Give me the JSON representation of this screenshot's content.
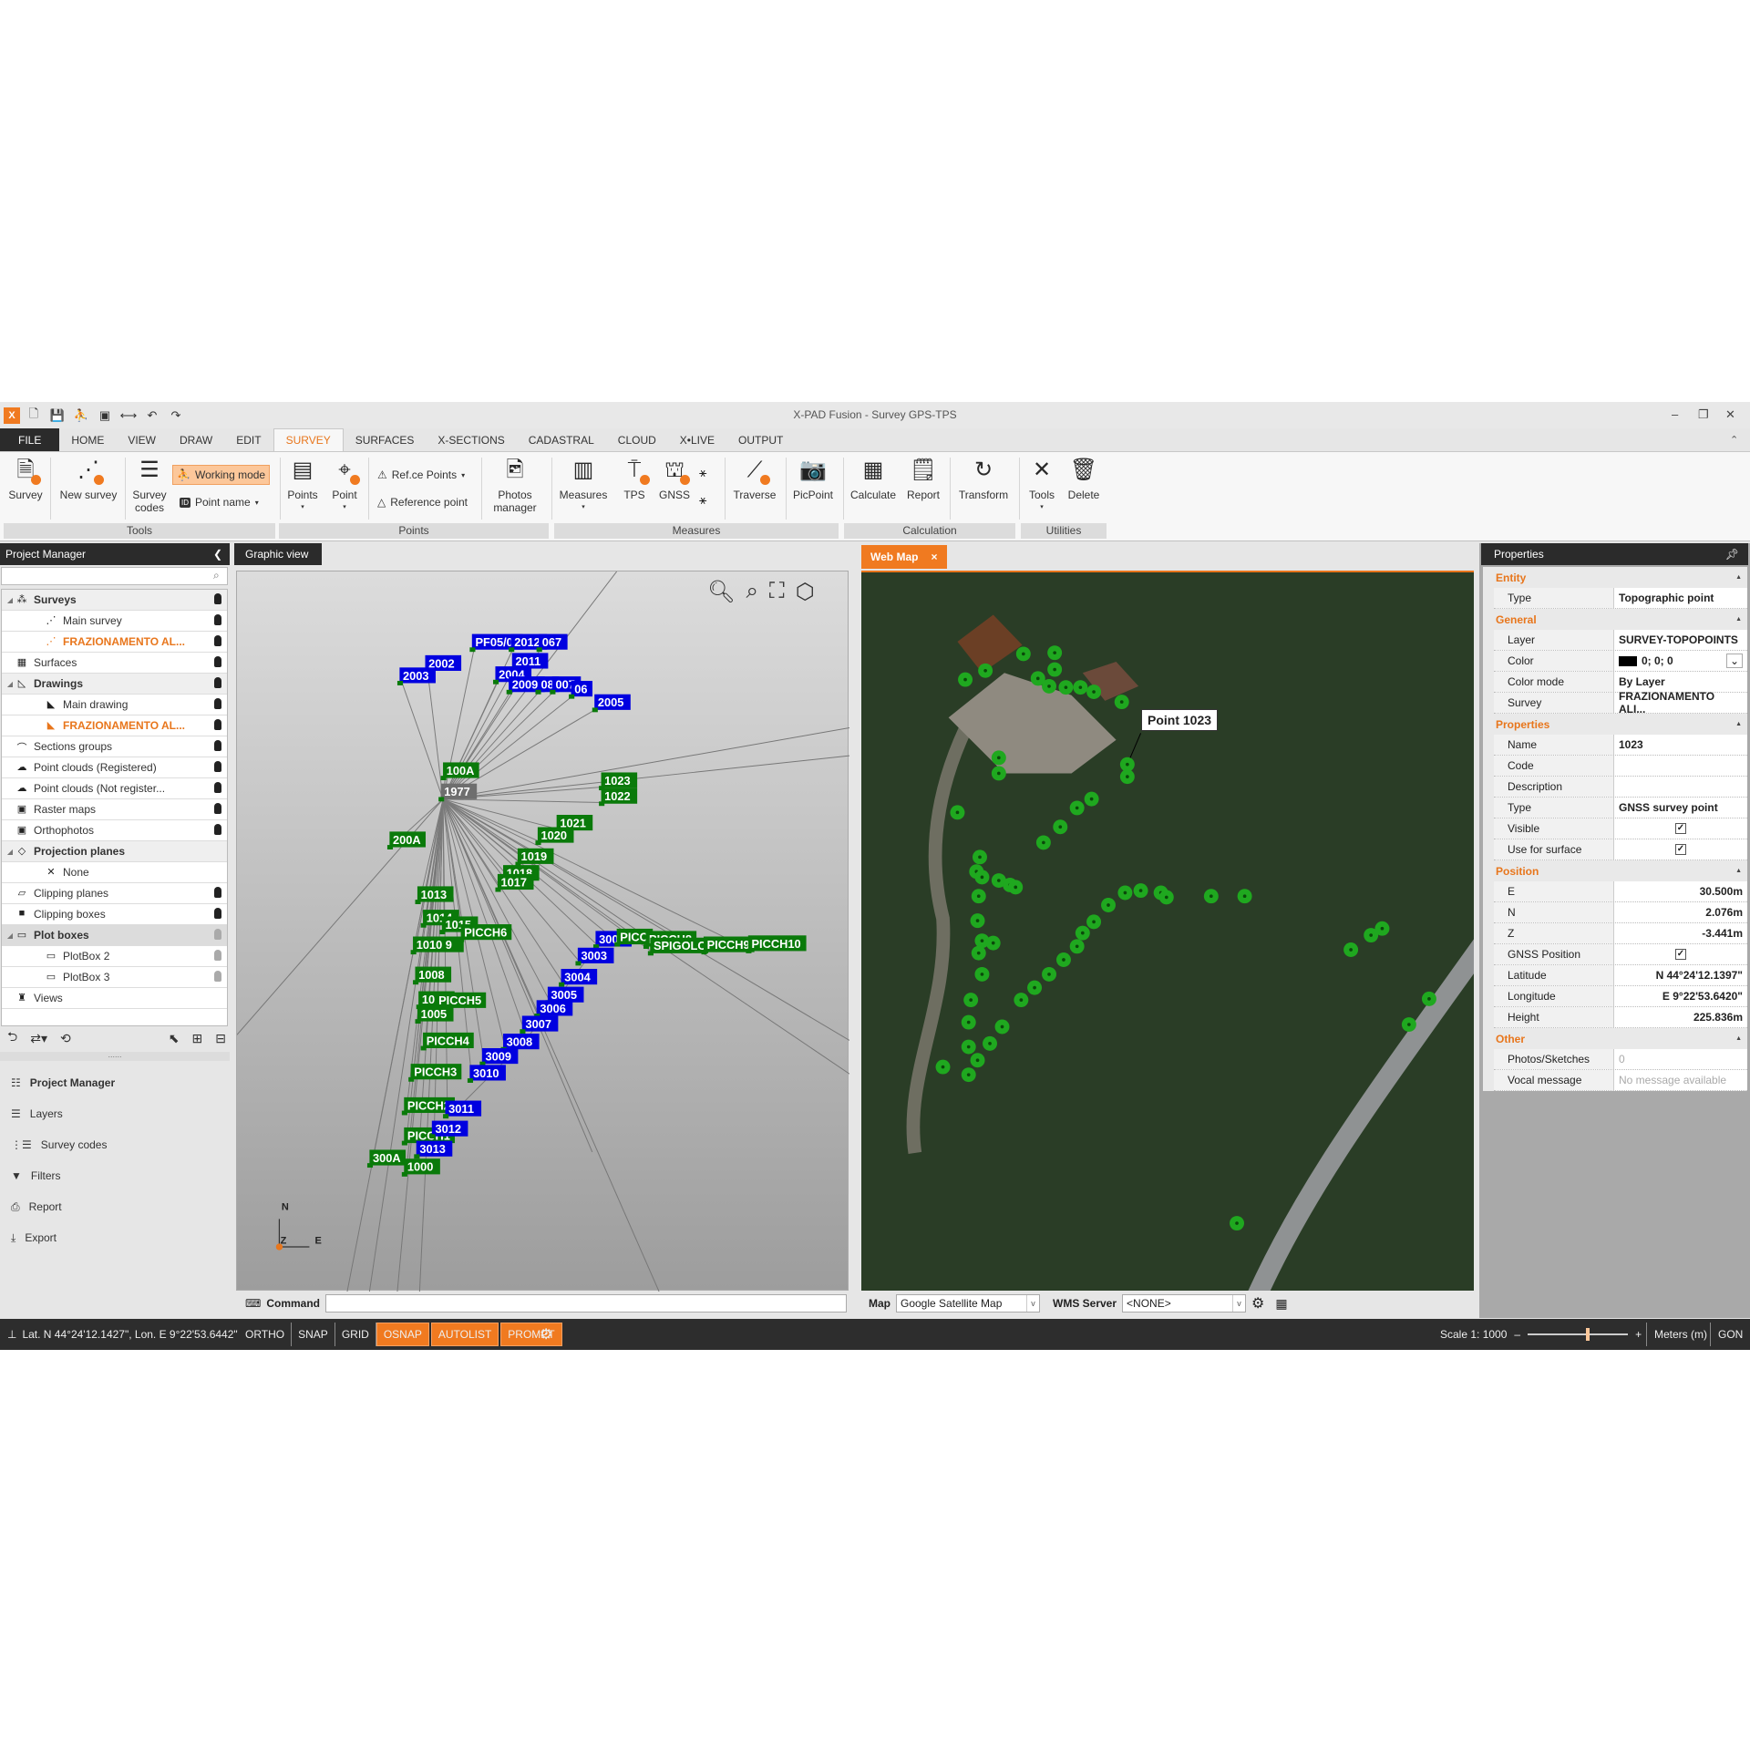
{
  "window": {
    "title": "X-PAD Fusion - Survey GPS-TPS"
  },
  "menu_tabs": [
    {
      "label": "FILE"
    },
    {
      "label": "HOME"
    },
    {
      "label": "VIEW"
    },
    {
      "label": "DRAW"
    },
    {
      "label": "EDIT"
    },
    {
      "label": "SURVEY",
      "active": true
    },
    {
      "label": "SURFACES"
    },
    {
      "label": "X-SECTIONS"
    },
    {
      "label": "CADASTRAL"
    },
    {
      "label": "CLOUD"
    },
    {
      "label": "X•LIVE"
    },
    {
      "label": "OUTPUT"
    }
  ],
  "ribbon": {
    "survey": "Survey",
    "new_survey": "New survey",
    "survey_codes": "Survey codes",
    "working_mode": "Working mode",
    "point_name": "Point name",
    "points": "Points",
    "point": "Point",
    "refce_points": "Ref.ce Points",
    "reference_point": "Reference point",
    "photos_manager": "Photos manager",
    "measures": "Measures",
    "tps": "TPS",
    "gnss": "GNSS",
    "traverse": "Traverse",
    "picpoint": "PicPoint",
    "calculate": "Calculate",
    "report": "Report",
    "transform": "Transform",
    "tools": "Tools",
    "delete": "Delete",
    "groups": {
      "tools": "Tools",
      "points": "Points",
      "measures": "Measures",
      "calculation": "Calculation",
      "utilities": "Utilities"
    }
  },
  "project_manager": {
    "title": "Project Manager",
    "search_placeholder": "",
    "tree": [
      {
        "label": "Surveys",
        "level": 0,
        "group": true,
        "expanded": true,
        "icon": "surveys-icon",
        "bulb": "on"
      },
      {
        "label": "Main survey",
        "level": 1,
        "icon": "survey-icon",
        "bulb": "on"
      },
      {
        "label": "FRAZIONAMENTO AL...",
        "level": 1,
        "active": true,
        "icon": "survey-icon",
        "bulb": "on"
      },
      {
        "label": "Surfaces",
        "level": 0,
        "icon": "surfaces-icon",
        "bulb": "on"
      },
      {
        "label": "Drawings",
        "level": 0,
        "group": true,
        "expanded": true,
        "icon": "drawings-icon",
        "bulb": "on"
      },
      {
        "label": "Main drawing",
        "level": 1,
        "icon": "drawing-icon",
        "bulb": "on"
      },
      {
        "label": "FRAZIONAMENTO AL...",
        "level": 1,
        "active": true,
        "icon": "drawing-icon",
        "bulb": "on"
      },
      {
        "label": "Sections groups",
        "level": 0,
        "icon": "sections-icon",
        "bulb": "on"
      },
      {
        "label": "Point clouds (Registered)",
        "level": 0,
        "icon": "cloud-icon",
        "bulb": "on"
      },
      {
        "label": "Point clouds (Not register...",
        "level": 0,
        "icon": "cloud-warning-icon",
        "bulb": "on"
      },
      {
        "label": "Raster maps",
        "level": 0,
        "icon": "raster-icon",
        "bulb": "on"
      },
      {
        "label": "Orthophotos",
        "level": 0,
        "icon": "orthophoto-icon",
        "bulb": "on"
      },
      {
        "label": "Projection planes",
        "level": 0,
        "group": true,
        "expanded": true,
        "icon": "plane-icon",
        "bulb": "none"
      },
      {
        "label": "None",
        "level": 1,
        "icon": "plane-none-icon",
        "bulb": "none"
      },
      {
        "label": "Clipping planes",
        "level": 0,
        "icon": "clipping-plane-icon",
        "bulb": "on"
      },
      {
        "label": "Clipping boxes",
        "level": 0,
        "icon": "clipping-box-icon",
        "bulb": "on"
      },
      {
        "label": "Plot boxes",
        "level": 0,
        "group": true,
        "expanded": true,
        "selected": true,
        "icon": "plotbox-icon",
        "bulb": "off"
      },
      {
        "label": "PlotBox 2",
        "level": 1,
        "icon": "plotbox-icon",
        "bulb": "off"
      },
      {
        "label": "PlotBox 3",
        "level": 1,
        "icon": "plotbox-icon",
        "bulb": "off"
      },
      {
        "label": "Views",
        "level": 0,
        "icon": "views-icon",
        "bulb": "none"
      }
    ],
    "nav": [
      {
        "label": "Project Manager",
        "icon": "list-icon",
        "active": true
      },
      {
        "label": "Layers",
        "icon": "layers-icon"
      },
      {
        "label": "Survey codes",
        "icon": "codes-icon"
      },
      {
        "label": "Filters",
        "icon": "filter-icon"
      },
      {
        "label": "Report",
        "icon": "printer-icon"
      },
      {
        "label": "Export",
        "icon": "export-icon"
      }
    ]
  },
  "graphic_view": {
    "tab": "Graphic view",
    "command_label": "Command",
    "command_value": "",
    "axis": {
      "n": "N",
      "z": "Z",
      "e": "E"
    },
    "labels": [
      {
        "text": "PF05/0",
        "kind": "blue"
      },
      {
        "text": "2012",
        "kind": "blue"
      },
      {
        "text": "067",
        "kind": "blue"
      },
      {
        "text": "2002",
        "kind": "blue"
      },
      {
        "text": "2003",
        "kind": "blue"
      },
      {
        "text": "2011",
        "kind": "blue"
      },
      {
        "text": "2004",
        "kind": "blue"
      },
      {
        "text": "2009",
        "kind": "blue"
      },
      {
        "text": "08",
        "kind": "blue"
      },
      {
        "text": "007",
        "kind": "blue"
      },
      {
        "text": "06",
        "kind": "blue"
      },
      {
        "text": "2005",
        "kind": "blue"
      },
      {
        "text": "100A",
        "kind": "green"
      },
      {
        "text": "1977",
        "kind": "gray"
      },
      {
        "text": "1023",
        "kind": "green"
      },
      {
        "text": "1022",
        "kind": "green"
      },
      {
        "text": "1021",
        "kind": "green"
      },
      {
        "text": "1020",
        "kind": "green"
      },
      {
        "text": "200A",
        "kind": "green"
      },
      {
        "text": "1019",
        "kind": "green"
      },
      {
        "text": "1018",
        "kind": "green"
      },
      {
        "text": "1017",
        "kind": "green"
      },
      {
        "text": "1013",
        "kind": "green"
      },
      {
        "text": "1014",
        "kind": "green"
      },
      {
        "text": "1015",
        "kind": "green"
      },
      {
        "text": "PICCH6",
        "kind": "green"
      },
      {
        "text": "1010 9",
        "kind": "green"
      },
      {
        "text": "1008",
        "kind": "green"
      },
      {
        "text": "1006",
        "kind": "green"
      },
      {
        "text": "PICCH5",
        "kind": "green"
      },
      {
        "text": "1005",
        "kind": "green"
      },
      {
        "text": "PICCH4",
        "kind": "green"
      },
      {
        "text": "PICCH3",
        "kind": "green"
      },
      {
        "text": "PICCH2",
        "kind": "green"
      },
      {
        "text": "PICCH1",
        "kind": "green"
      },
      {
        "text": "300A",
        "kind": "green"
      },
      {
        "text": "1000",
        "kind": "green"
      },
      {
        "text": "3002",
        "kind": "blue"
      },
      {
        "text": "3003",
        "kind": "blue"
      },
      {
        "text": "3004",
        "kind": "blue"
      },
      {
        "text": "3005",
        "kind": "blue"
      },
      {
        "text": "3006",
        "kind": "blue"
      },
      {
        "text": "3007",
        "kind": "blue"
      },
      {
        "text": "3008",
        "kind": "blue"
      },
      {
        "text": "3009",
        "kind": "blue"
      },
      {
        "text": "3010",
        "kind": "blue"
      },
      {
        "text": "3011",
        "kind": "blue"
      },
      {
        "text": "3012",
        "kind": "blue"
      },
      {
        "text": "3013",
        "kind": "blue"
      },
      {
        "text": "PICC",
        "kind": "green"
      },
      {
        "text": "PICCH8",
        "kind": "green"
      },
      {
        "text": "SPIGOLO",
        "kind": "green"
      },
      {
        "text": "PICCH9",
        "kind": "green"
      },
      {
        "text": "PICCH10",
        "kind": "green"
      }
    ],
    "colors": {
      "blue": "#0000e0",
      "green": "#0a7a0a",
      "gray": "#6e6e6e"
    }
  },
  "web_map": {
    "tab": "Web Map",
    "tooltip": "Point 1023",
    "map_label": "Map",
    "map_value": "Google Satellite Map",
    "wms_label": "WMS Server",
    "wms_value": "<NONE>",
    "point_color": "#1fa81f"
  },
  "properties": {
    "title": "Properties",
    "sections": [
      {
        "title": "Entity",
        "rows": [
          {
            "key": "Type",
            "value": "Topographic point"
          }
        ]
      },
      {
        "title": "General",
        "rows": [
          {
            "key": "Layer",
            "value": "SURVEY-TOPOPOINTS"
          },
          {
            "key": "Color",
            "value": "0; 0; 0",
            "swatch": "#000000"
          },
          {
            "key": "Color mode",
            "value": "By Layer"
          },
          {
            "key": "Survey",
            "value": "FRAZIONAMENTO ALI..."
          }
        ]
      },
      {
        "title": "Properties",
        "rows": [
          {
            "key": "Name",
            "value": "1023"
          },
          {
            "key": "Code",
            "value": ""
          },
          {
            "key": "Description",
            "value": ""
          },
          {
            "key": "Type",
            "value": "GNSS survey point"
          },
          {
            "key": "Visible",
            "checked": true
          },
          {
            "key": "Use for surface",
            "checked": true
          }
        ]
      },
      {
        "title": "Position",
        "rows": [
          {
            "key": "E",
            "value": "30.500m",
            "align": "r"
          },
          {
            "key": "N",
            "value": "2.076m",
            "align": "r"
          },
          {
            "key": "Z",
            "value": "-3.441m",
            "align": "r"
          },
          {
            "key": "GNSS Position",
            "checked": true
          },
          {
            "key": "Latitude",
            "value": "N 44°24'12.1397\"",
            "align": "r"
          },
          {
            "key": "Longitude",
            "value": "E 9°22'53.6420\"",
            "align": "r"
          },
          {
            "key": "Height",
            "value": "225.836m",
            "align": "r"
          }
        ]
      },
      {
        "title": "Other",
        "rows": [
          {
            "key": "Photos/Sketches",
            "value": "0",
            "dim": true
          },
          {
            "key": "Vocal message",
            "value": "No message available",
            "dim": true
          }
        ]
      }
    ]
  },
  "status": {
    "coords": "Lat. N 44°24'12.1427\", Lon. E 9°22'53.6442\"",
    "toggles": [
      {
        "label": "ORTHO",
        "on": false
      },
      {
        "label": "SNAP",
        "on": false
      },
      {
        "label": "GRID",
        "on": false
      },
      {
        "label": "OSNAP",
        "on": true
      },
      {
        "label": "AUTOLIST",
        "on": true
      },
      {
        "label": "PROMPT",
        "on": true
      }
    ],
    "scale": "Scale 1: 1000",
    "scale_slider": 0.6,
    "units": "Meters (m)",
    "angle": "GON",
    "accent": "#f07a20"
  }
}
